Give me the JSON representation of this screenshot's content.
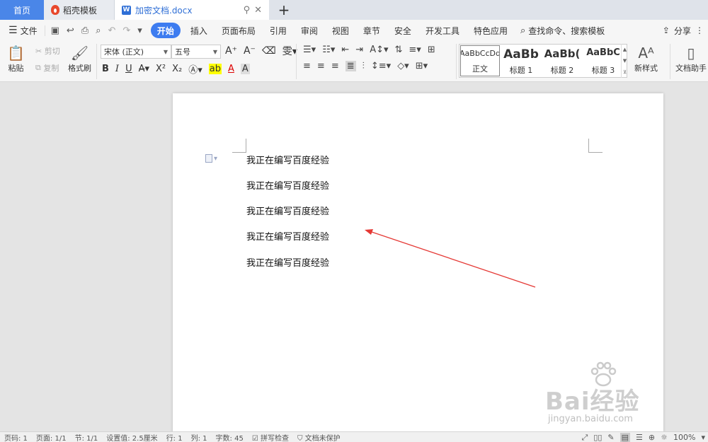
{
  "titlebar": {
    "home_tab": "首页",
    "template_tab": "稻壳模板",
    "doc_tab": "加密文档.docx",
    "pin_icon": "pin-icon",
    "close_icon": "close-icon",
    "new_tab": "+"
  },
  "menubar": {
    "file": "文件",
    "items": [
      "开始",
      "插入",
      "页面布局",
      "引用",
      "审阅",
      "视图",
      "章节",
      "安全",
      "开发工具",
      "特色应用"
    ],
    "active": "开始",
    "search": "查找命令、搜索模板",
    "share": "分享"
  },
  "ribbon": {
    "paste": "粘贴",
    "cut": "剪切",
    "copy": "复制",
    "format_painter": "格式刷",
    "font_name": "宋体 (正文)",
    "font_size": "五号",
    "bold": "B",
    "italic": "I",
    "underline": "U",
    "styles": [
      {
        "sample": "AaBbCcDd",
        "label": "正文"
      },
      {
        "sample": "AaBb",
        "label": "标题 1"
      },
      {
        "sample": "AaBb(",
        "label": "标题 2"
      },
      {
        "sample": "AaBbC",
        "label": "标题 3"
      }
    ],
    "new_style": "新样式",
    "doc_assistant": "文档助手"
  },
  "document": {
    "lines": [
      "我正在编写百度经验",
      "我正在编写百度经验",
      "我正在编写百度经验",
      "我正在编写百度经验",
      "我正在编写百度经验"
    ]
  },
  "watermark": {
    "logo": "Bai经验",
    "url": "jingyan.baidu.com"
  },
  "statusbar": {
    "page_num": "页码: 1",
    "pages": "页面: 1/1",
    "section": "节: 1/1",
    "setting": "设置值: 2.5厘米",
    "row": "行: 1",
    "col": "列: 1",
    "words": "字数: 45",
    "spell": "拼写检查",
    "protect": "文档未保护",
    "zoom": "100%"
  },
  "colors": {
    "accent": "#3d7cf0",
    "home_tab": "#4a86e8",
    "arrow": "#e53935"
  }
}
